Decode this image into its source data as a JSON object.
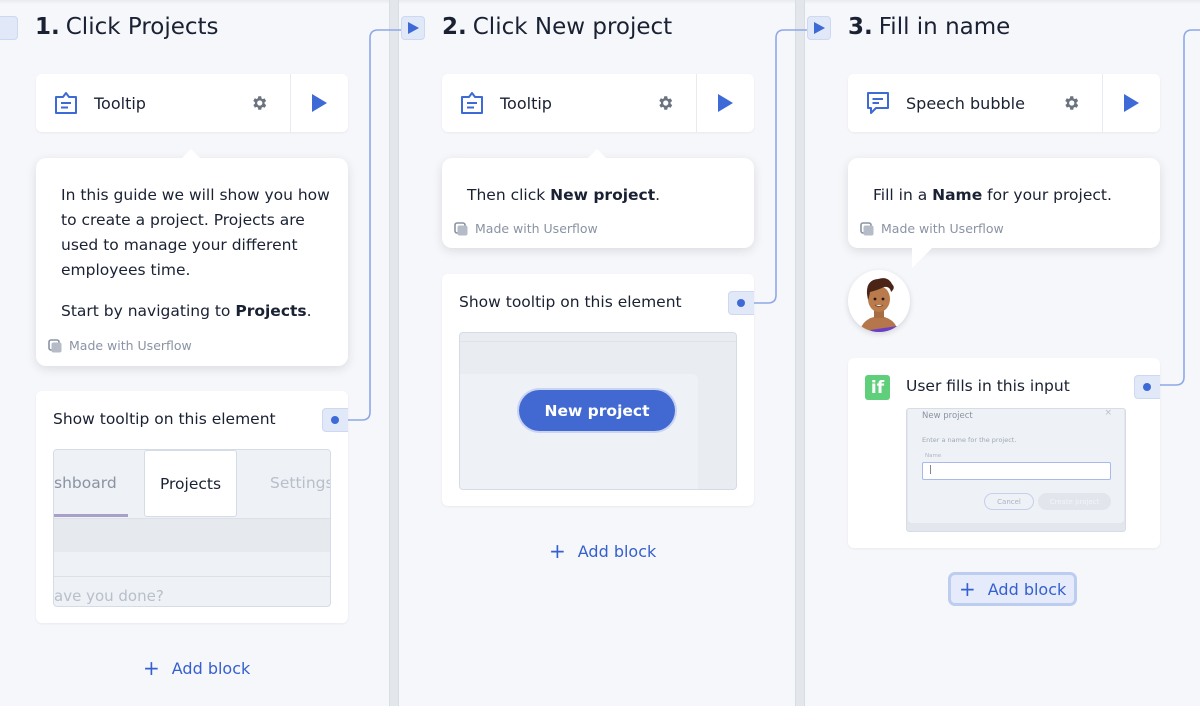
{
  "colors": {
    "accent": "#3d6ad6",
    "connector": "#8ea8e8",
    "background": "#f6f7fa",
    "if_badge": "#5fcf7b"
  },
  "steps": [
    {
      "number": "1.",
      "title": "Click Projects",
      "block": {
        "icon": "tooltip-icon",
        "label": "Tooltip"
      },
      "bubble": {
        "paragraphs": [
          {
            "text": "In this guide we will show you how to create a project. Projects are used to manage your different employees time."
          },
          {
            "prefix": "Start by navigating to ",
            "bold": "Projects",
            "suffix": "."
          }
        ],
        "branding": "Made with Userflow"
      },
      "target": {
        "label": "Show tooltip on this element",
        "preview": {
          "tabs": [
            "shboard",
            "Projects",
            "Settings"
          ],
          "placeholder": "ave you done?"
        }
      },
      "add_block": "Add block"
    },
    {
      "number": "2.",
      "title": "Click New project",
      "block": {
        "icon": "tooltip-icon",
        "label": "Tooltip"
      },
      "bubble": {
        "prefix": "Then click ",
        "bold": "New project",
        "suffix": ".",
        "branding": "Made with Userflow"
      },
      "target": {
        "label": "Show tooltip on this element",
        "preview": {
          "button": "New project"
        }
      },
      "add_block": "Add block"
    },
    {
      "number": "3.",
      "title": "Fill in name",
      "block": {
        "icon": "speech-bubble-icon",
        "label": "Speech bubble"
      },
      "bubble": {
        "prefix": "Fill in a ",
        "bold": "Name",
        "suffix": " for your project.",
        "branding": "Made with Userflow"
      },
      "condition": {
        "badge": "if",
        "label": "User fills in this input",
        "preview": {
          "dialog_title": "New project",
          "description": "Enter a name for the project.",
          "field_label": "Name",
          "field_value": "|",
          "cancel": "Cancel",
          "create": "Create project"
        }
      },
      "add_block": "Add block"
    }
  ]
}
